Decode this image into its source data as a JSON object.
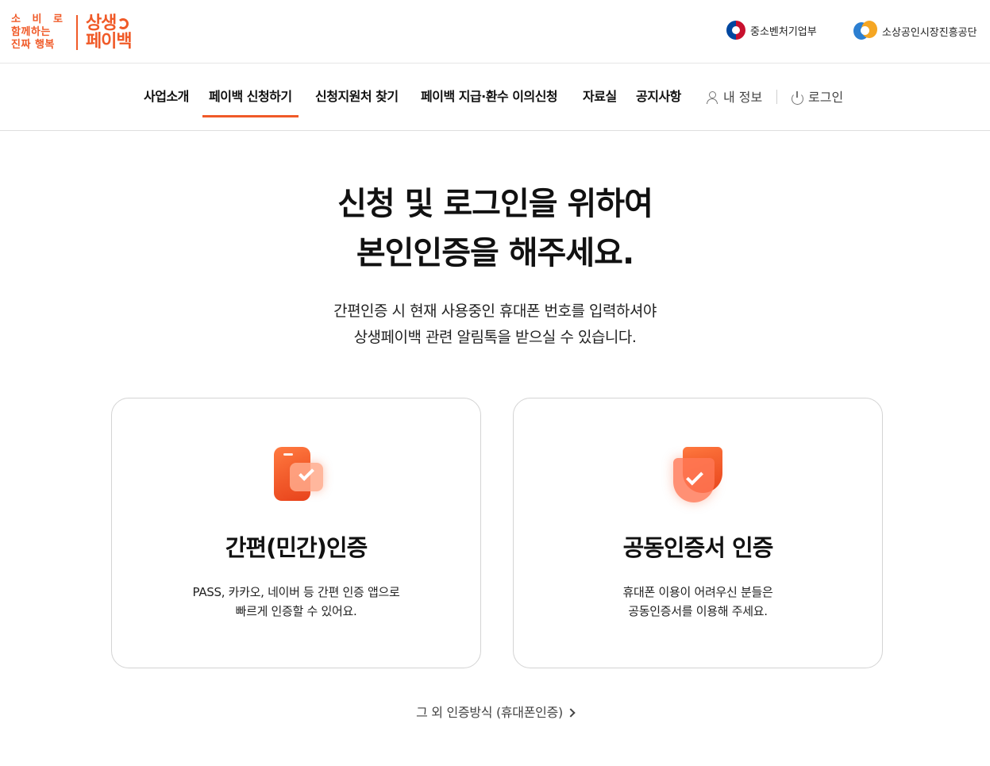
{
  "header": {
    "slogan": [
      "소 비 로",
      "함께하는",
      "진짜 행복"
    ],
    "brand_line1": "상생",
    "brand_line2": "페이백",
    "org1": "중소벤처기업부",
    "org2": "소상공인시장진흥공단"
  },
  "nav": {
    "items": [
      {
        "label": "사업소개"
      },
      {
        "label": "페이백 신청하기",
        "active": true
      },
      {
        "label": "신청지원처 찾기"
      },
      {
        "label": "페이백 지급·환수 이의신청"
      },
      {
        "label": "자료실"
      },
      {
        "label": "공지사항"
      }
    ],
    "my_info": "내 정보",
    "login": "로그인"
  },
  "main": {
    "headline_line1": "신청 및 로그인을 위하여",
    "headline_line2": "본인인증을 해주세요.",
    "sub_line1": "간편인증 시 현재 사용중인 휴대폰 번호를 입력하셔야",
    "sub_line2": "상생페이백 관련 알림톡을 받으실 수 있습니다."
  },
  "cards": [
    {
      "title": "간편(민간)인증",
      "desc_line1": "PASS, 카카오, 네이버 등 간편 인증 앱으로",
      "desc_line2": "빠르게 인증할 수 있어요.",
      "icon": "phone-check-icon"
    },
    {
      "title": "공동인증서 인증",
      "desc_line1": "휴대폰 이용이 어려우신 분들은",
      "desc_line2": "공동인증서를 이용해 주세요.",
      "icon": "shield-check-icon"
    }
  ],
  "other_auth": "그 외 인증방식 (휴대폰인증)",
  "colors": {
    "accent": "#f05a28",
    "text": "#111111",
    "border": "#d4d4d4"
  }
}
